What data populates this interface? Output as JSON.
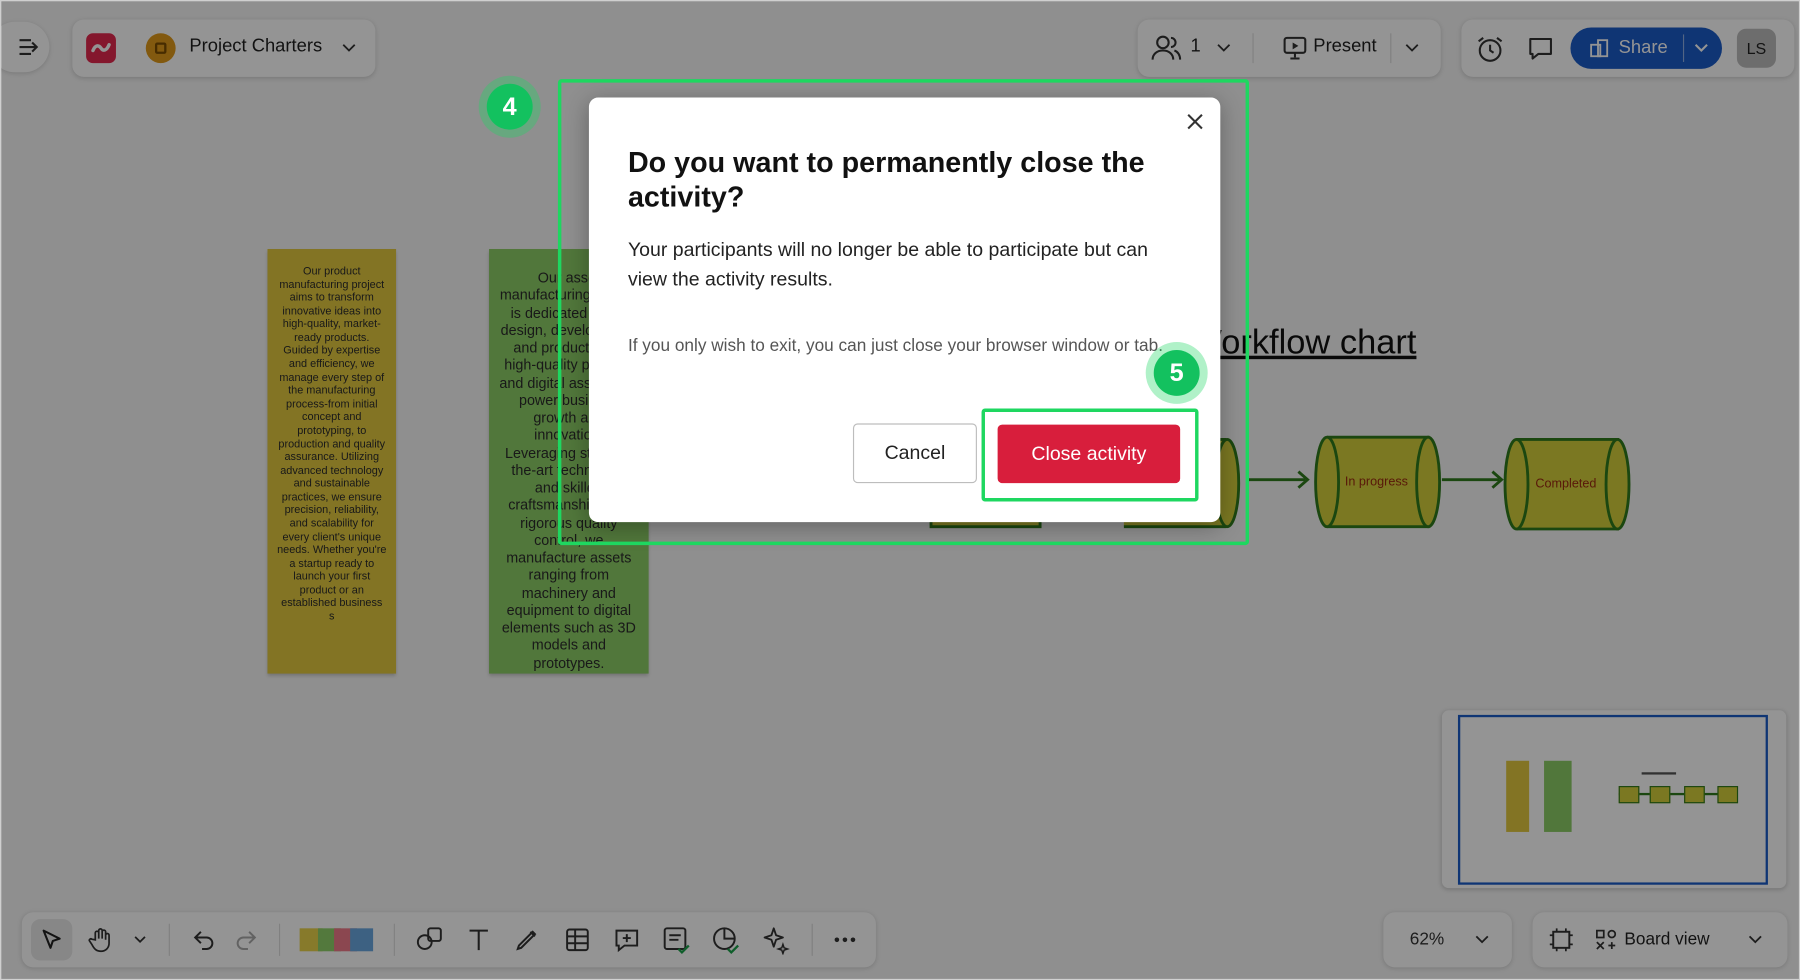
{
  "topbar": {
    "project_title": "Project Charters",
    "participants_count": "1",
    "present_label": "Present",
    "share_label": "Share",
    "avatar_initials": "LS"
  },
  "board": {
    "note1_text": "Our product manufacturing project aims to transform innovative ideas into high-quality, market-ready products. Guided by expertise and efficiency, we manage every step of the manufacturing process-from initial concept and prototyping, to production and quality assurance. Utilizing advanced technology and sustainable practices, we ensure precision, reliability, and scalability for every client's unique needs. Whether you're a startup ready to launch your first product or an established business",
    "note2_text": "Our asset manufacturing project is dedicated to the design, development, and production of high-quality physical and digital assets that power business growth and innovation. Leveraging state-of-the-art technology and skilled craftsmanship, and rigorous quality control, we manufacture assets ranging from machinery and equipment to digital elements such as 3D models and prototypes.",
    "workflow_title": "Workflow chart",
    "stage_in_progress": "In progress",
    "stage_completed": "Completed"
  },
  "modal": {
    "title": "Do you want to permanently close the activity?",
    "description": "Your participants will no longer be able to participate but can view the activity results.",
    "note": "If you only wish to exit, you can just close your browser window or tab.",
    "cancel_label": "Cancel",
    "confirm_label": "Close activity"
  },
  "annotations": {
    "step4": "4",
    "step5": "5"
  },
  "bottombar": {
    "zoom_level": "62%",
    "board_view_label": "Board view"
  },
  "colors": {
    "accent_blue": "#1a5cc8",
    "danger_red": "#d81e3c",
    "highlight_green": "#1ed760",
    "note_yellow": "#e8d24a",
    "note_green": "#8fd06a"
  }
}
